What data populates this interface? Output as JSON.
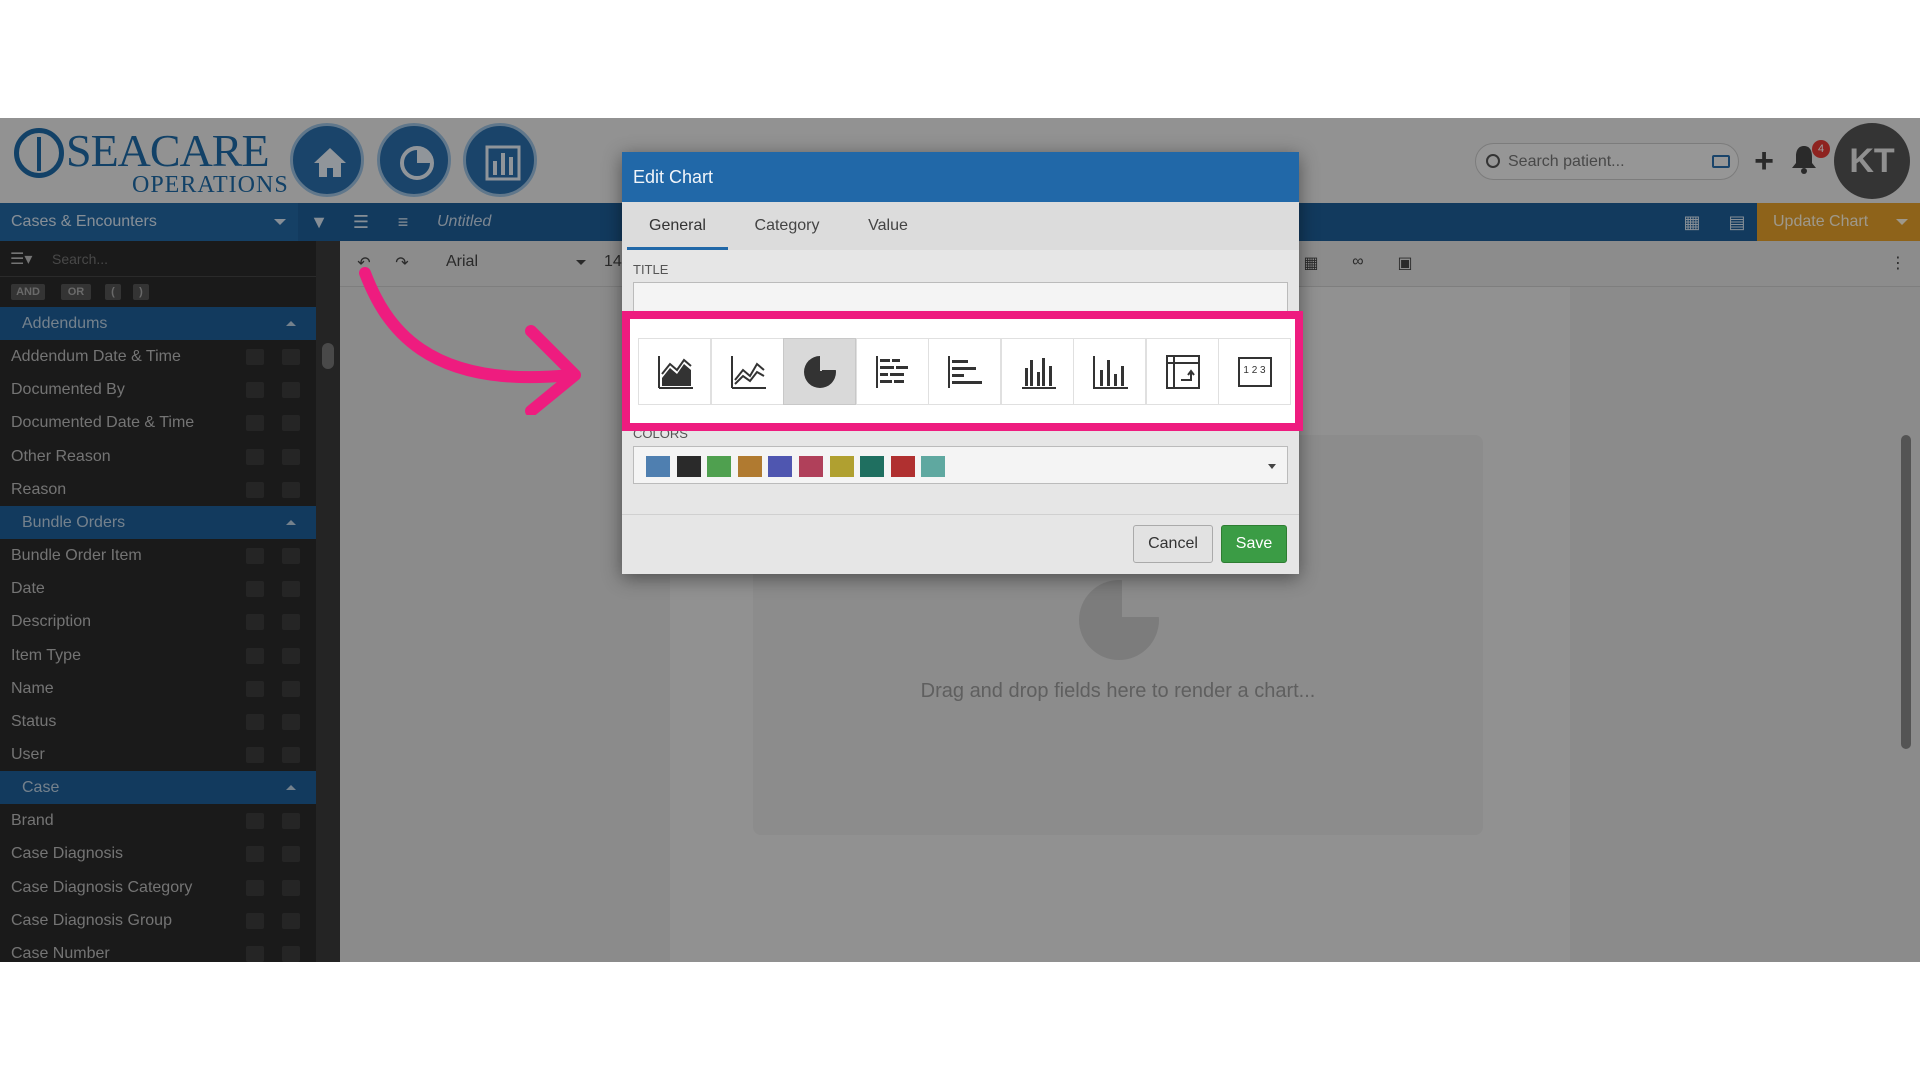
{
  "header": {
    "logo_text": "SEACARE",
    "logo_subtext": "OPERATIONS",
    "search_placeholder": "Search patient...",
    "notification_count": "4",
    "avatar_initials": "KT"
  },
  "toolbar": {
    "source": "Cases & Encounters",
    "report_name": "Untitled",
    "update_label": "Update Chart"
  },
  "sidebar": {
    "search_placeholder": "Search...",
    "logic": {
      "and": "AND",
      "or": "OR",
      "open_paren": "(",
      "close_paren": ")"
    },
    "groups": [
      {
        "name": "Addendums",
        "fields": [
          "Addendum Date & Time",
          "Documented By",
          "Documented Date & Time",
          "Other Reason",
          "Reason"
        ]
      },
      {
        "name": "Bundle Orders",
        "fields": [
          "Bundle Order Item",
          "Date",
          "Description",
          "Item Type",
          "Name",
          "Status",
          "User"
        ]
      },
      {
        "name": "Case",
        "fields": [
          "Brand",
          "Case Diagnosis",
          "Case Diagnosis Category",
          "Case Diagnosis Group",
          "Case Number"
        ]
      }
    ]
  },
  "editor": {
    "font": "Arial",
    "font_size": "14"
  },
  "canvas": {
    "placeholder_text": "Drag and drop fields here to render a chart..."
  },
  "modal": {
    "title": "Edit Chart",
    "tabs": {
      "general": "General",
      "category": "Category",
      "value": "Value"
    },
    "active_tab": "General",
    "title_label": "TITLE",
    "title_value": "",
    "colors_label": "COLORS",
    "colors": [
      "#4f7fb0",
      "#2a2a2a",
      "#4fa04f",
      "#b07a30",
      "#4f56b0",
      "#b0405a",
      "#b0a030",
      "#1f6f60",
      "#b03030",
      "#5fa8a0"
    ],
    "chart_types": [
      {
        "icon": "area-chart-icon",
        "selected": false
      },
      {
        "icon": "line-chart-icon",
        "selected": false
      },
      {
        "icon": "pie-chart-icon",
        "selected": true
      },
      {
        "icon": "stacked-bar-chart-icon",
        "selected": false
      },
      {
        "icon": "horizontal-bar-chart-icon",
        "selected": false
      },
      {
        "icon": "grouped-column-chart-icon",
        "selected": false
      },
      {
        "icon": "column-chart-icon",
        "selected": false
      },
      {
        "icon": "pivot-table-icon",
        "selected": false
      },
      {
        "icon": "number-card-icon",
        "selected": false
      }
    ],
    "number_card_text": "1 2 3",
    "cancel_label": "Cancel",
    "save_label": "Save"
  },
  "accent": {
    "brand": "#1d6aa6",
    "highlight": "#ee1c7f",
    "update": "#e5a02a",
    "save": "#3b9c45"
  }
}
